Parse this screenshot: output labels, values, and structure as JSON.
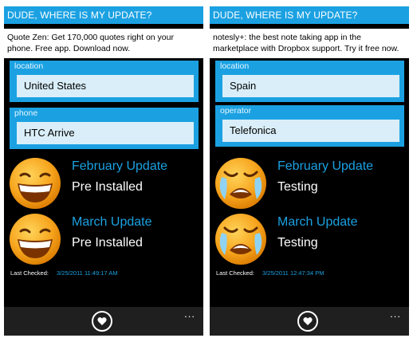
{
  "app": {
    "title": "DUDE, WHERE IS MY UPDATE?"
  },
  "colors": {
    "accent": "#1ba1e2",
    "background": "#000000",
    "happy_face": "#f5a623",
    "sad_face": "#f5a623"
  },
  "left": {
    "ad_text": "Quote Zen: Get 170,000 quotes right on your phone. Free app.  Download now.",
    "field1": {
      "label": "location",
      "value": "United States"
    },
    "field2": {
      "label": "phone",
      "value": "HTC Arrive"
    },
    "updates": [
      {
        "title": "February Update",
        "status": "Pre Installed",
        "icon": "happy-face-icon"
      },
      {
        "title": "March Update",
        "status": "Pre Installed",
        "icon": "happy-face-icon"
      }
    ],
    "last_checked_label": "Last Checked:",
    "last_checked_value": "3/25/2011 11:49:17 AM"
  },
  "right": {
    "ad_text": "notesly+: the best note taking app in the marketplace with Dropbox support.  Try it free now.",
    "field1": {
      "label": "location",
      "value": "Spain"
    },
    "field2": {
      "label": "operator",
      "value": "Telefonica"
    },
    "updates": [
      {
        "title": "February Update",
        "status": "Testing",
        "icon": "crying-face-icon"
      },
      {
        "title": "March Update",
        "status": "Testing",
        "icon": "crying-face-icon"
      }
    ],
    "last_checked_label": "Last Checked:",
    "last_checked_value": "3/25/2011 12:47:34 PM"
  },
  "appbar": {
    "icon": "heart-icon",
    "more_icon": "ellipsis-icon",
    "more_label": "..."
  }
}
